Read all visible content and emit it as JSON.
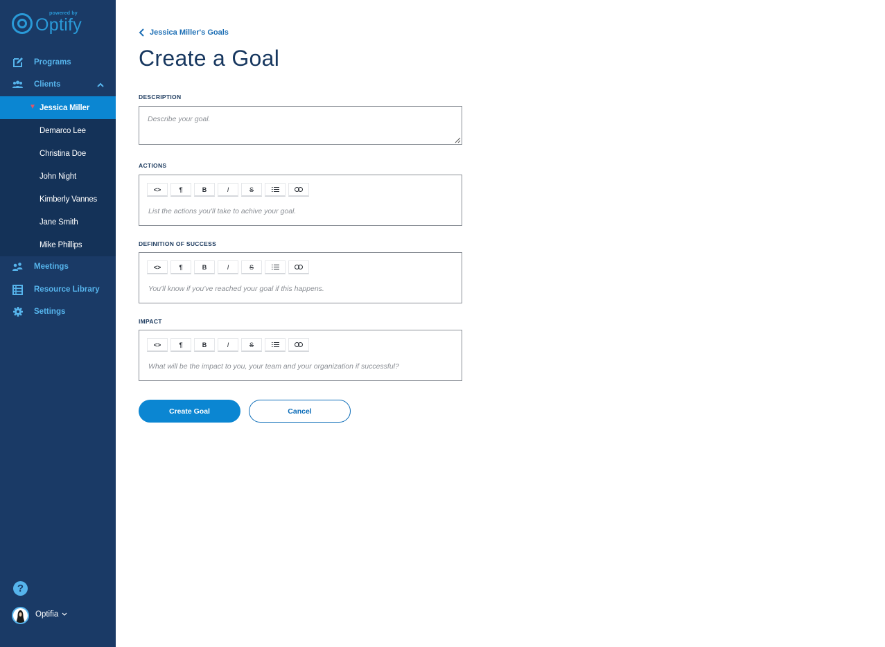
{
  "app": {
    "logo_powered_by": "powered by",
    "logo_name": "Optify"
  },
  "sidebar": {
    "nav": [
      {
        "label": "Programs",
        "icon": "edit-icon"
      },
      {
        "label": "Clients",
        "icon": "clients-icon"
      },
      {
        "label": "Meetings",
        "icon": "meetings-icon"
      },
      {
        "label": "Resource Library",
        "icon": "library-icon"
      },
      {
        "label": "Settings",
        "icon": "gear-icon"
      }
    ],
    "clients": [
      {
        "label": "Jessica Miller",
        "active": true
      },
      {
        "label": "Demarco Lee"
      },
      {
        "label": "Christina Doe"
      },
      {
        "label": "John Night"
      },
      {
        "label": "Kimberly Vannes"
      },
      {
        "label": "Jane Smith"
      },
      {
        "label": "Mike Phillips"
      }
    ],
    "help_icon": "?",
    "user_name": "Optifia"
  },
  "main": {
    "back_link": "Jessica Miller's Goals",
    "title": "Create a Goal",
    "description": {
      "label": "DESCRIPTION",
      "placeholder": "Describe your goal."
    },
    "toolbar": [
      "<>",
      "¶",
      "B",
      "I",
      "S",
      "list",
      "link"
    ],
    "actions": {
      "label": "ACTIONS",
      "placeholder": "List the actions you'll take to achive your goal."
    },
    "success": {
      "label": "DEFINITION OF SUCCESS",
      "placeholder": "You'll know if you've reached your goal if this happens."
    },
    "impact": {
      "label": "IMPACT",
      "placeholder": "What will be the impact to you, your team and your organization if successful?"
    },
    "create_button": "Create Goal",
    "cancel_button": "Cancel"
  },
  "colors": {
    "sidebar_bg": "#1a3a66",
    "accent": "#0b86d2",
    "nav_text": "#56b4ec"
  }
}
